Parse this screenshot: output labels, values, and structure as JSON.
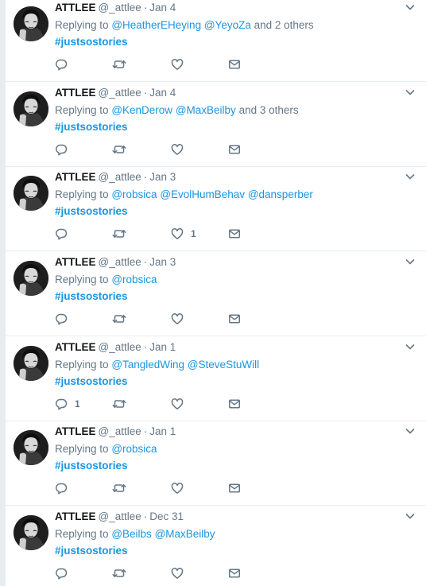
{
  "tweets": [
    {
      "name": "ATTLEE",
      "handle": "@_attlee",
      "time": "Jan 4",
      "replying_label": "Replying to",
      "mentions": [
        "@HeatherEHeying",
        "@YeyoZa"
      ],
      "others": "and 2 others",
      "hashtag": "#justsostories",
      "reply_count": "",
      "like_count": ""
    },
    {
      "name": "ATTLEE",
      "handle": "@_attlee",
      "time": "Jan 4",
      "replying_label": "Replying to",
      "mentions": [
        "@KenDerow",
        "@MaxBeilby"
      ],
      "others": "and 3 others",
      "hashtag": "#justsostories",
      "reply_count": "",
      "like_count": ""
    },
    {
      "name": "ATTLEE",
      "handle": "@_attlee",
      "time": "Jan 3",
      "replying_label": "Replying to",
      "mentions": [
        "@robsica",
        "@EvolHumBehav",
        "@dansperber"
      ],
      "others": "",
      "hashtag": "#justsostories",
      "reply_count": "",
      "like_count": "1"
    },
    {
      "name": "ATTLEE",
      "handle": "@_attlee",
      "time": "Jan 3",
      "replying_label": "Replying to",
      "mentions": [
        "@robsica"
      ],
      "others": "",
      "hashtag": "#justsostories",
      "reply_count": "",
      "like_count": ""
    },
    {
      "name": "ATTLEE",
      "handle": "@_attlee",
      "time": "Jan 1",
      "replying_label": "Replying to",
      "mentions": [
        "@TangledWing",
        "@SteveStuWill"
      ],
      "others": "",
      "hashtag": "#justsostories",
      "reply_count": "1",
      "like_count": ""
    },
    {
      "name": "ATTLEE",
      "handle": "@_attlee",
      "time": "Jan 1",
      "replying_label": "Replying to",
      "mentions": [
        "@robsica"
      ],
      "others": "",
      "hashtag": "#justsostories",
      "reply_count": "",
      "like_count": ""
    },
    {
      "name": "ATTLEE",
      "handle": "@_attlee",
      "time": "Dec 31",
      "replying_label": "Replying to",
      "mentions": [
        "@Beilbs",
        "@MaxBeilby"
      ],
      "others": "",
      "hashtag": "#justsostories",
      "reply_count": "",
      "like_count": ""
    }
  ],
  "icons": {
    "reply": "reply-icon",
    "retweet": "retweet-icon",
    "like": "heart-icon",
    "dm": "envelope-icon",
    "caret": "chevron-down-icon",
    "avatar": "avatar"
  },
  "colors": {
    "link": "#1b95e0",
    "muted": "#657786",
    "name": "#14171a",
    "background": "#e6ecf0"
  }
}
